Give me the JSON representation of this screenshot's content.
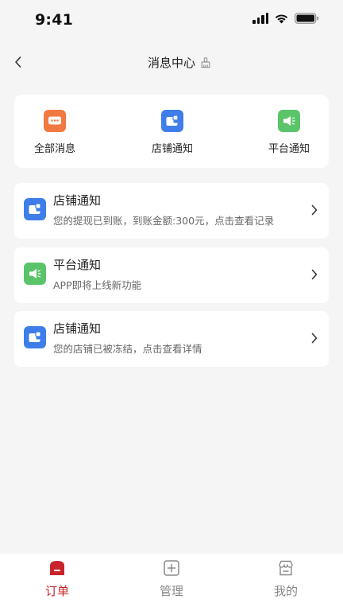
{
  "status_bar": {
    "time": "9:41"
  },
  "nav": {
    "title": "消息中心"
  },
  "categories": [
    {
      "label": "全部消息",
      "icon": "chat-icon",
      "color": "#f07a41"
    },
    {
      "label": "店铺通知",
      "icon": "wallet-icon",
      "color": "#3f7ee8"
    },
    {
      "label": "平台通知",
      "icon": "speaker-icon",
      "color": "#5bc46a"
    }
  ],
  "messages": [
    {
      "title": "店铺通知",
      "desc": "您的提现已到账，到账金额:300元，点击查看记录",
      "icon": "wallet-icon",
      "color": "#3f7ee8"
    },
    {
      "title": "平台通知",
      "desc": "APP即将上线新功能",
      "icon": "speaker-icon",
      "color": "#5bc46a"
    },
    {
      "title": "店铺通知",
      "desc": "您的店铺已被冻结，点击查看详情",
      "icon": "wallet-icon",
      "color": "#3f7ee8"
    }
  ],
  "tabs": [
    {
      "label": "订单",
      "icon": "order-icon",
      "active": true,
      "color": "#c8242a"
    },
    {
      "label": "管理",
      "icon": "manage-icon",
      "active": false,
      "color": "#888888"
    },
    {
      "label": "我的",
      "icon": "store-icon",
      "active": false,
      "color": "#888888"
    }
  ]
}
